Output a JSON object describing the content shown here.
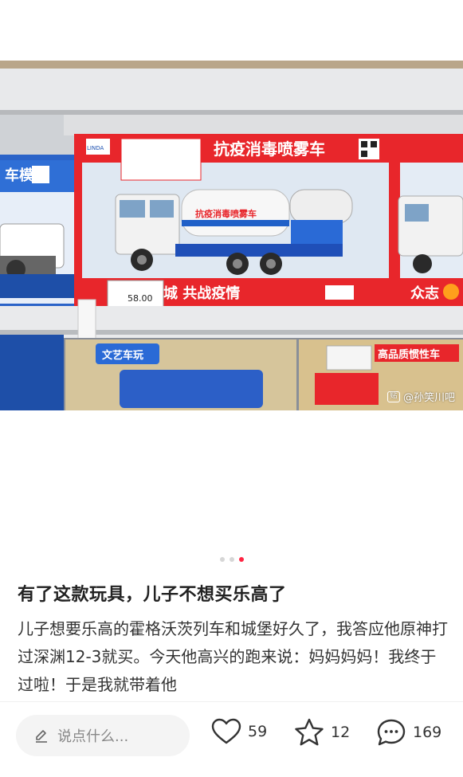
{
  "photo": {
    "box_main_title": "抗疫消毒喷雾车",
    "box_main_footer": "城 共战疫情",
    "box_right_footer": "众志",
    "truck_tank_text": "抗疫消毒喷雾车",
    "left_box_title": "车模",
    "brand_logo": "LINDA",
    "price_tag": "58.00",
    "shelf_brand": "文艺车玩",
    "lower_box_title": "高品质惯性车",
    "watermark": "@孙笑川吧"
  },
  "carousel": {
    "count": 3,
    "active_index": 2
  },
  "post": {
    "title": "有了这款玩具，儿子不想买乐高了",
    "body": "儿子想要乐高的霍格沃茨列车和城堡好久了，我答应他原神打过深渊12-3就买。今天他高兴的跑来说：妈妈妈妈！我终于过啦！于是我就带着他"
  },
  "bottom_bar": {
    "comment_placeholder": "说点什么...",
    "likes": "59",
    "collects": "12",
    "comments": "169"
  },
  "colors": {
    "accent": "#ff2442",
    "box_red": "#e8262b"
  }
}
